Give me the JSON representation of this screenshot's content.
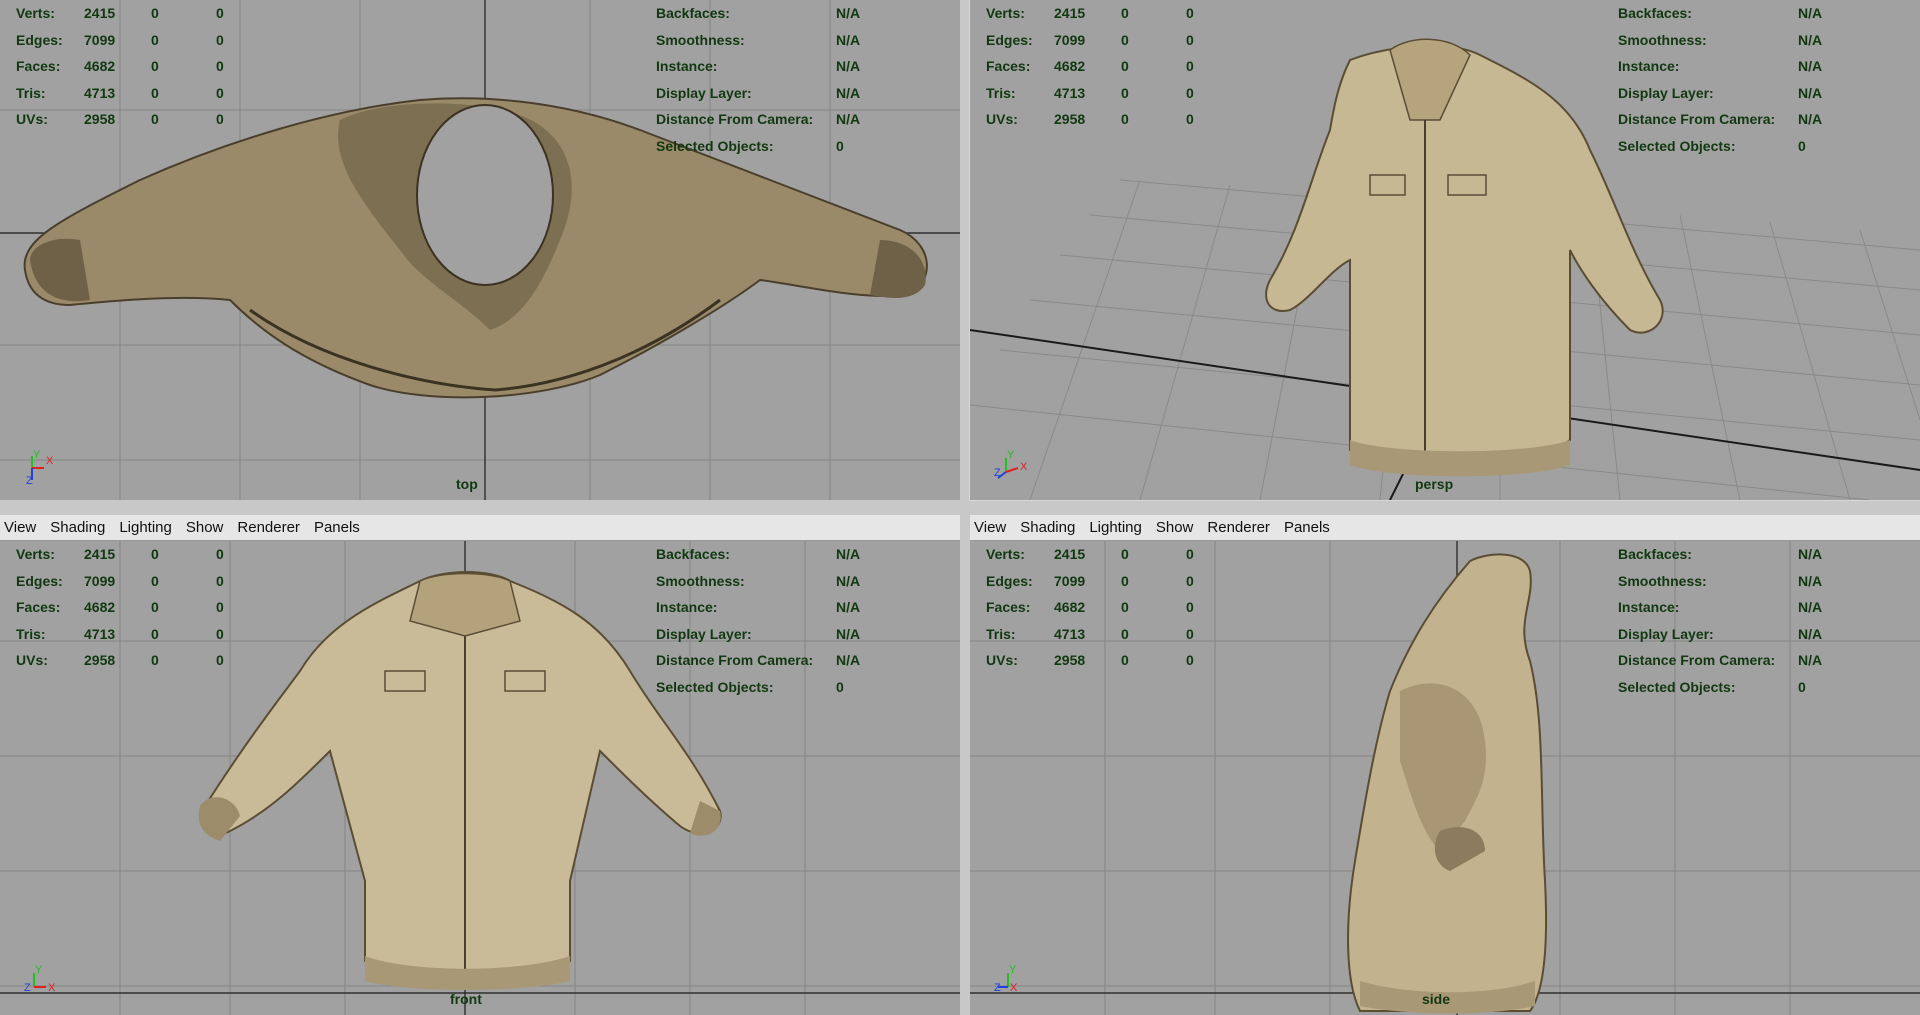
{
  "menu": [
    "View",
    "Shading",
    "Lighting",
    "Show",
    "Renderer",
    "Panels"
  ],
  "hud": {
    "stats": [
      {
        "label": "Verts:",
        "values": [
          "2415",
          "0",
          "0"
        ]
      },
      {
        "label": "Edges:",
        "values": [
          "7099",
          "0",
          "0"
        ]
      },
      {
        "label": "Faces:",
        "values": [
          "4682",
          "0",
          "0"
        ]
      },
      {
        "label": "Tris:",
        "values": [
          "4713",
          "0",
          "0"
        ]
      },
      {
        "label": "UVs:",
        "values": [
          "2958",
          "0",
          "0"
        ]
      }
    ],
    "info": [
      {
        "label": "Backfaces:",
        "value": "N/A"
      },
      {
        "label": "Smoothness:",
        "value": "N/A"
      },
      {
        "label": "Instance:",
        "value": "N/A"
      },
      {
        "label": "Display Layer:",
        "value": "N/A"
      },
      {
        "label": "Distance From Camera:",
        "value": "N/A"
      },
      {
        "label": "Selected Objects:",
        "value": "0"
      }
    ]
  },
  "viewports": [
    {
      "camera": "top"
    },
    {
      "camera": "persp"
    },
    {
      "camera": "front"
    },
    {
      "camera": "side"
    }
  ],
  "axis_labels": {
    "x": "X",
    "y": "Y",
    "z": "Z"
  },
  "colors": {
    "viewport_bg": "#a1a1a1",
    "grid": "#808080",
    "hud_text": "#113811",
    "jacket": "#b8a98a",
    "axis_x": "#e02020",
    "axis_y": "#20c020",
    "axis_z": "#2040e0"
  }
}
